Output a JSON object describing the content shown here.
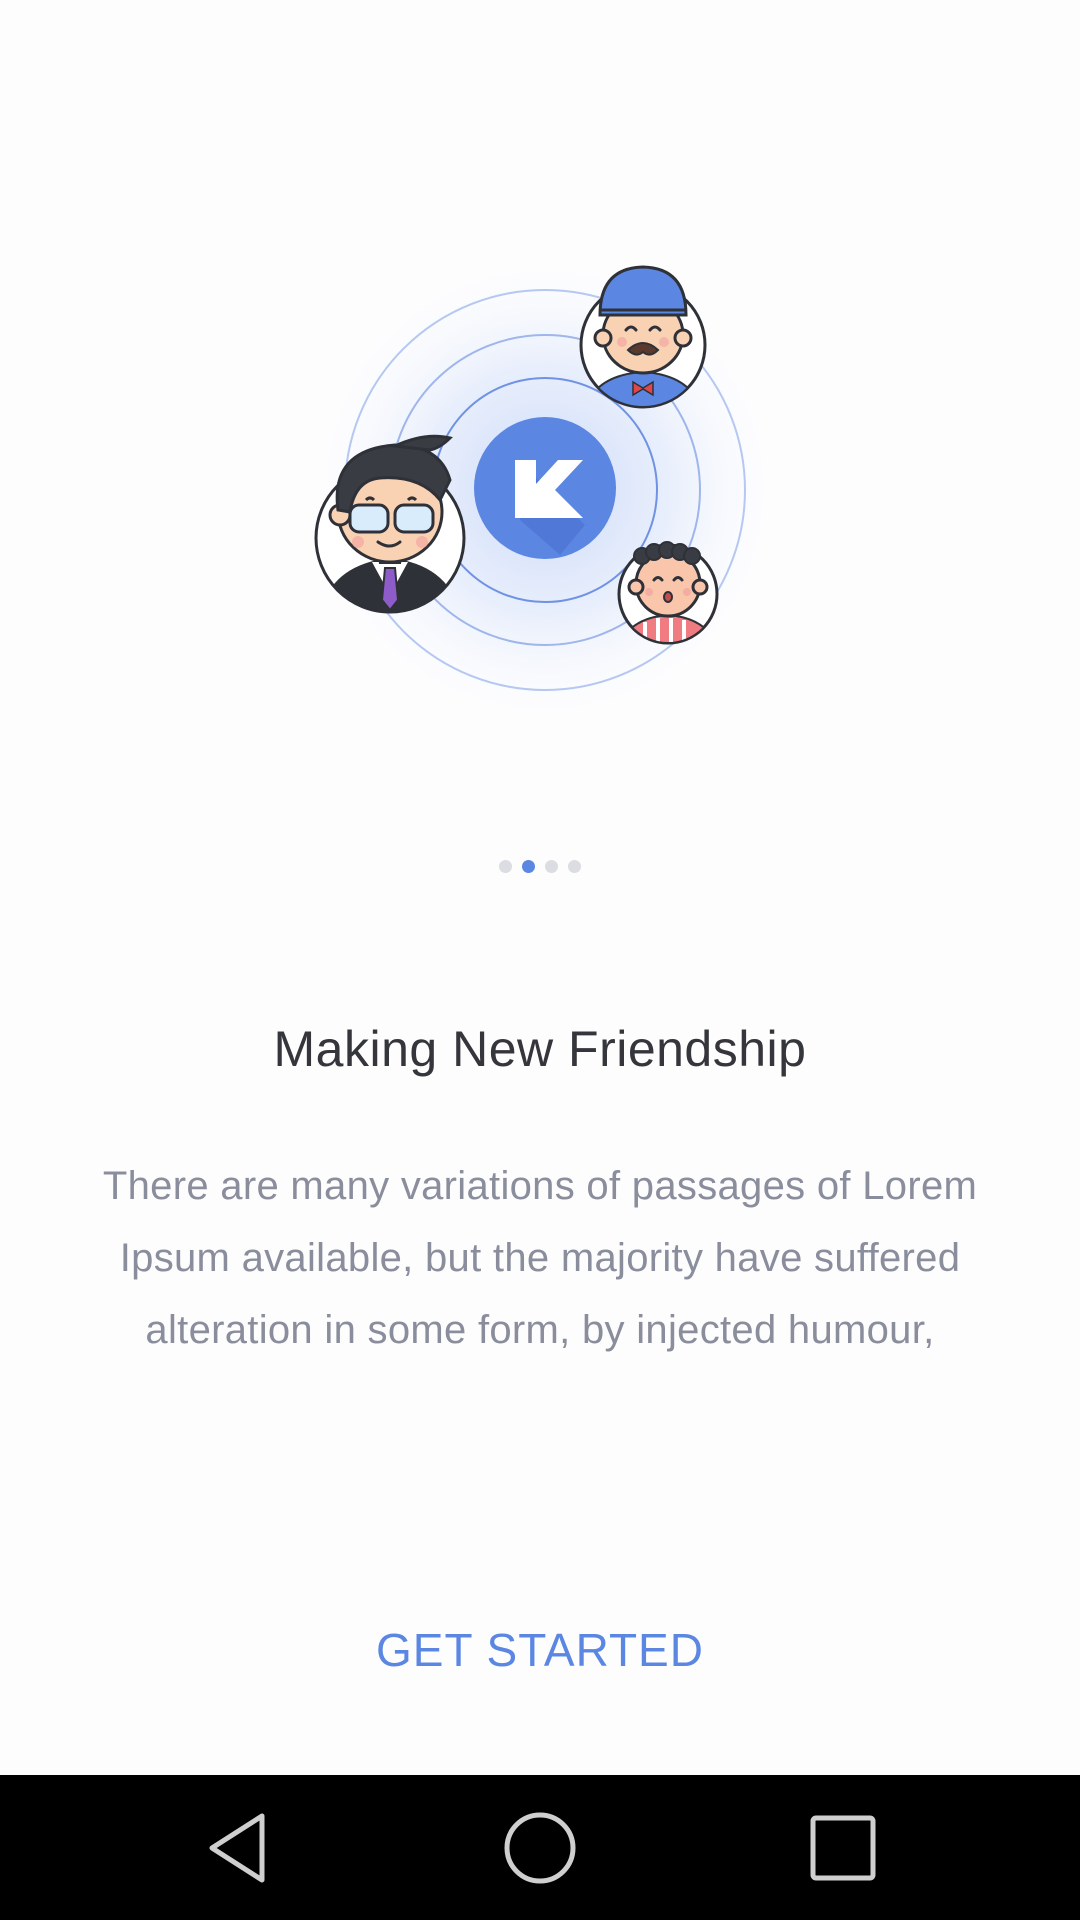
{
  "onboarding": {
    "title": "Making New Friendship",
    "description": "There are many variations of passages of Lorem Ipsum available, but the majority have suffered alteration in some form, by injected humour,",
    "cta_label": "GET STARTED",
    "page_indicator": {
      "total": 4,
      "current": 2
    }
  },
  "logo_letter": "K",
  "colors": {
    "accent": "#5b87e3",
    "title": "#34363b",
    "body": "#8a8d9c",
    "dot_inactive": "#dcdde2",
    "navbar": "#000000"
  },
  "navbar": {
    "icons": [
      "back-icon",
      "home-icon",
      "recents-icon"
    ]
  }
}
